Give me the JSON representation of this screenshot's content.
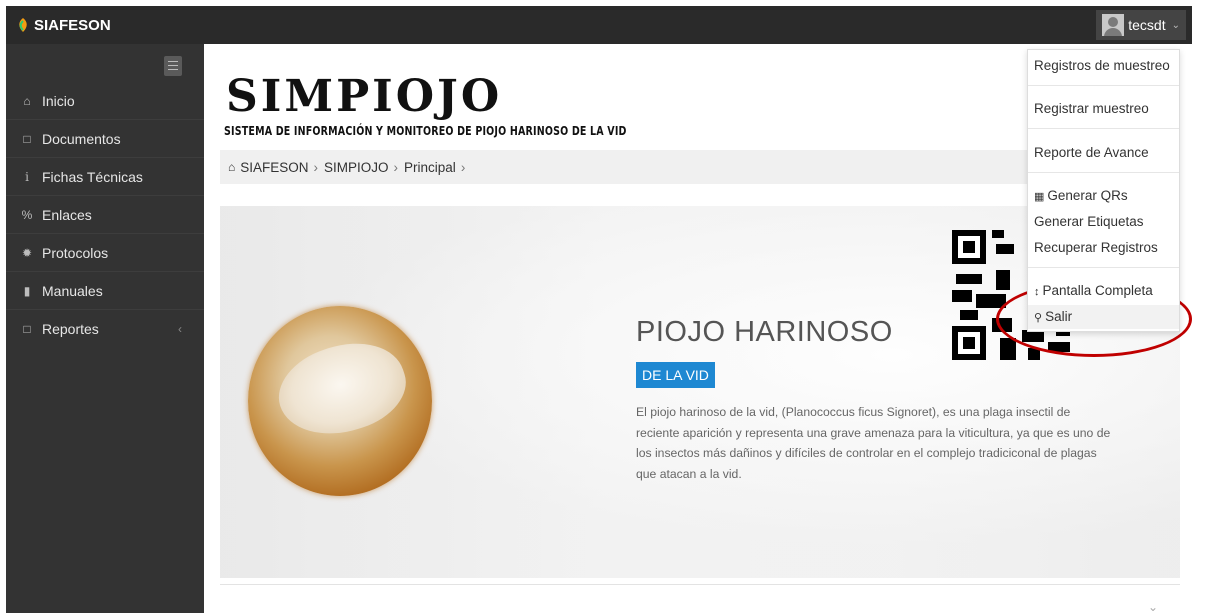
{
  "header": {
    "brand": "SIAFESON",
    "user_name": "tecsdt",
    "user_menu_chevron": "chevron-down-icon"
  },
  "sidebar": {
    "items": [
      {
        "label": "Inicio",
        "icon": "home-icon"
      },
      {
        "label": "Documentos",
        "icon": "folder-icon"
      },
      {
        "label": "Fichas Técnicas",
        "icon": "info-icon"
      },
      {
        "label": "Enlaces",
        "icon": "link-icon"
      },
      {
        "label": "Protocolos",
        "icon": "gear-icon"
      },
      {
        "label": "Manuales",
        "icon": "book-icon"
      },
      {
        "label": "Reportes",
        "icon": "file-icon"
      }
    ]
  },
  "main": {
    "logo": "SIMPIOJO",
    "subtitle": "SISTEMA DE INFORMACIÓN Y MONITOREO DE PIOJO HARINOSO DE LA VID",
    "breadcrumb": [
      "SIAFESON",
      "SIMPIOJO",
      "Principal"
    ],
    "hero": {
      "title": "PIOJO HARINOSO",
      "badge": "DE LA VID",
      "text": "El piojo harinoso de la vid, (Planococcus ficus Signoret), es una plaga insectil de reciente aparición y representa una grave amenaza para la viticultura, ya que es uno de los insectos más dañinos y difíciles de controlar en el complejo tradiciconal de plagas que atacan a la vid."
    }
  },
  "user_menu": {
    "items": {
      "registros": "Registros de muestreo",
      "registrar": "Registrar muestreo",
      "reporte": "Reporte de Avance",
      "qrs": "Generar QRs",
      "etiquetas": "Generar Etiquetas",
      "recuperar": "Recuperar Registros",
      "pantalla": "Pantalla Completa",
      "salir": "Salir"
    }
  },
  "colors": {
    "topbar": "#2a2a2a",
    "sidebar": "#333333",
    "badge": "#1e88d2",
    "highlight": "#c00000"
  }
}
